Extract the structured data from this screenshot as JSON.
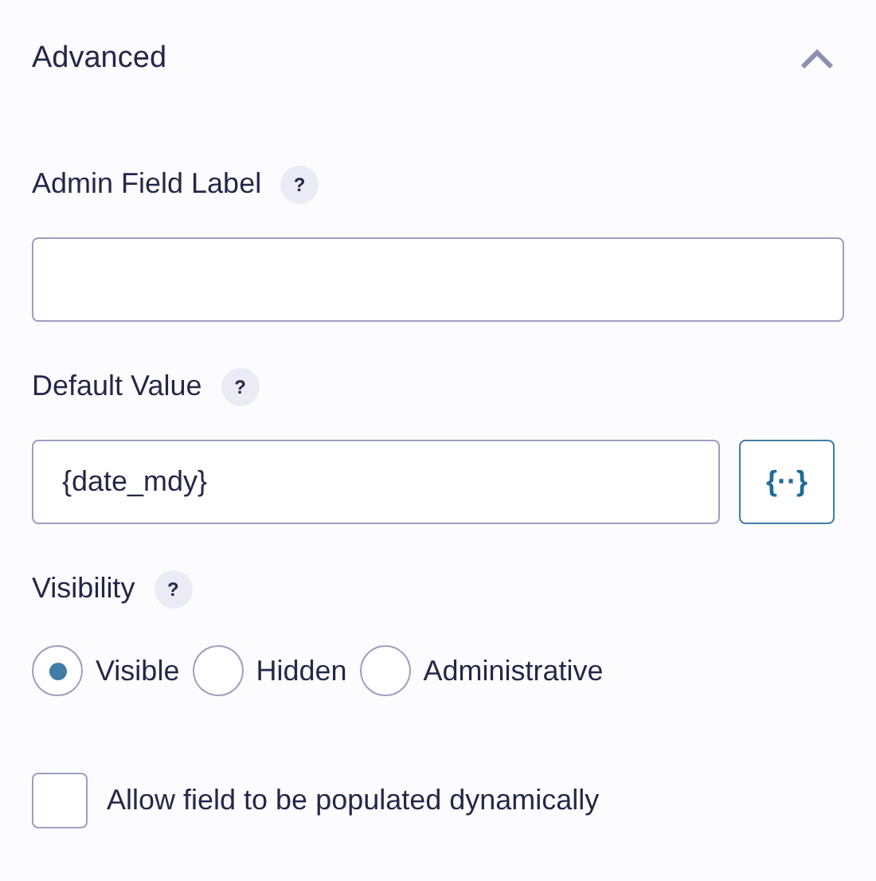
{
  "section": {
    "title": "Advanced",
    "expanded": true
  },
  "fields": [
    {
      "kind": "text",
      "label": "Admin Field Label",
      "help": "?"
    },
    {
      "kind": "merge",
      "label": "Default Value",
      "help": "?",
      "value": "{date_mdy}",
      "button": "{··}"
    }
  ],
  "visibility": {
    "label": "Visibility",
    "help": "?",
    "options": [
      {
        "label": "Visible",
        "selected": true
      },
      {
        "label": "Hidden",
        "selected": false
      },
      {
        "label": "Administrative",
        "selected": false
      }
    ]
  },
  "dynamic": {
    "label": "Allow field to be populated dynamically",
    "checked": false
  }
}
